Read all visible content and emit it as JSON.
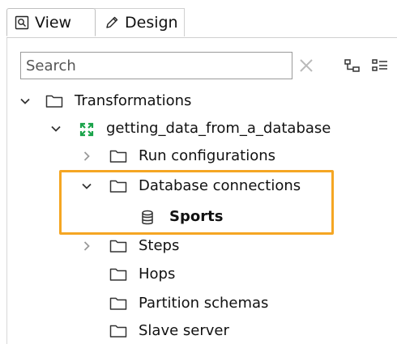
{
  "tabs": [
    {
      "label": "View",
      "icon": "view-icon",
      "active": true
    },
    {
      "label": "Design",
      "icon": "pencil-icon",
      "active": false
    }
  ],
  "search": {
    "placeholder": "Search",
    "value": ""
  },
  "toolbar": {
    "clear_icon": "clear-icon",
    "collapse_icon": "collapse-all-icon",
    "expand_icon": "expand-all-icon"
  },
  "tree": {
    "root": {
      "label": "Transformations",
      "icon": "folder-icon"
    },
    "transformation": {
      "label": "getting_data_from_a_database",
      "icon": "transformation-icon"
    },
    "run_configurations": {
      "label": "Run configurations",
      "icon": "folder-icon"
    },
    "database_connections": {
      "label": "Database connections",
      "icon": "folder-icon"
    },
    "sports": {
      "label": "Sports",
      "icon": "database-icon"
    },
    "steps": {
      "label": "Steps",
      "icon": "folder-icon"
    },
    "hops": {
      "label": "Hops",
      "icon": "folder-icon"
    },
    "partition_schemas": {
      "label": "Partition schemas",
      "icon": "folder-icon"
    },
    "slave_server": {
      "label": "Slave server",
      "icon": "folder-icon"
    }
  },
  "colors": {
    "highlight": "#f5a623",
    "transformation_icon": "#1aa34a"
  }
}
